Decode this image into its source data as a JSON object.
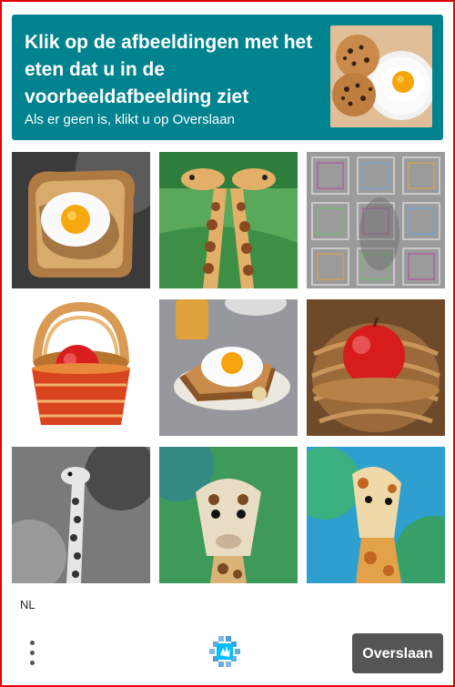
{
  "challenge": {
    "title": "Klik op de afbeeldingen met het eten dat u in de voorbeeldafbeelding ziet",
    "subtitle": "Als er geen is, klikt u op Overslaan",
    "header_color": "#00838f",
    "sample_image": "cookies-and-fried-egg"
  },
  "grid": {
    "tiles": [
      {
        "image": "egg-on-toast"
      },
      {
        "image": "two-giraffes-painting"
      },
      {
        "image": "noise-pattern"
      },
      {
        "image": "apple-in-red-basket"
      },
      {
        "image": "egg-on-toast-plate"
      },
      {
        "image": "apple-in-wicker-basket"
      },
      {
        "image": "giraffe-black-white"
      },
      {
        "image": "giraffe-head-green"
      },
      {
        "image": "giraffe-watercolor"
      }
    ]
  },
  "footer": {
    "language": "NL",
    "skip_label": "Overslaan",
    "menu_icon": "three-dots-vertical-icon",
    "logo": "hcaptcha-logo-icon",
    "skip_color": "#555555"
  },
  "frame_color": "#e30000"
}
